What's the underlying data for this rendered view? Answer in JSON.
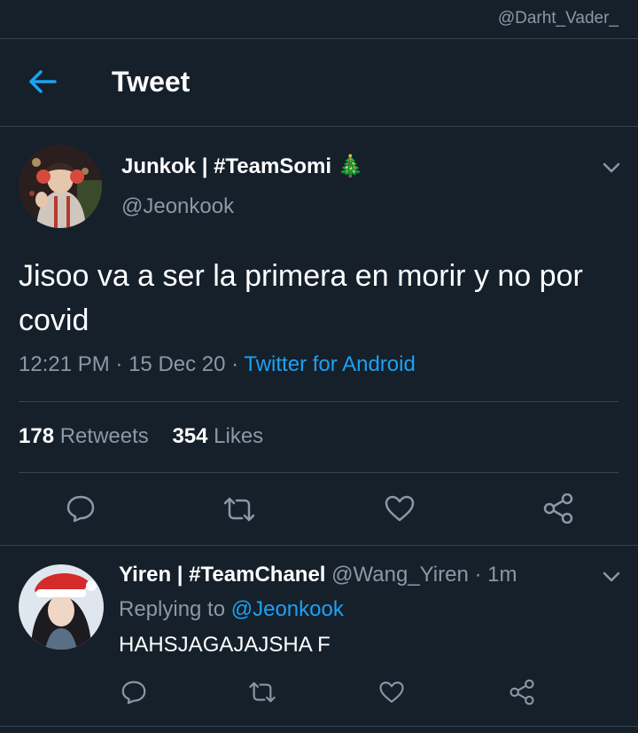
{
  "watermark": "@Darht_Vader_",
  "header": {
    "title": "Tweet"
  },
  "tweet": {
    "name": "Junkok | #TeamSomi",
    "name_emoji": "🎄",
    "handle": "@Jeonkook",
    "text": "Jisoo va a ser la primera en morir y no por covid",
    "time": "12:21 PM",
    "date": "15 Dec 20",
    "source": "Twitter for Android",
    "retweets_count": "178",
    "retweets_label": "Retweets",
    "likes_count": "354",
    "likes_label": "Likes"
  },
  "reply": {
    "name": "Yiren | #TeamChanel",
    "handle": "@Wang_Yiren",
    "time": "1m",
    "replying_label": "Replying to",
    "replying_handle": "@Jeonkook",
    "text": "HAHSJAGAJAJSHA F"
  },
  "colors": {
    "background": "#15202b",
    "accent": "#1da1f2",
    "muted": "#8b98a5",
    "divider": "#38444d"
  },
  "icons": [
    "back-arrow-icon",
    "chevron-down-icon",
    "reply-icon",
    "retweet-icon",
    "like-icon",
    "share-icon"
  ]
}
